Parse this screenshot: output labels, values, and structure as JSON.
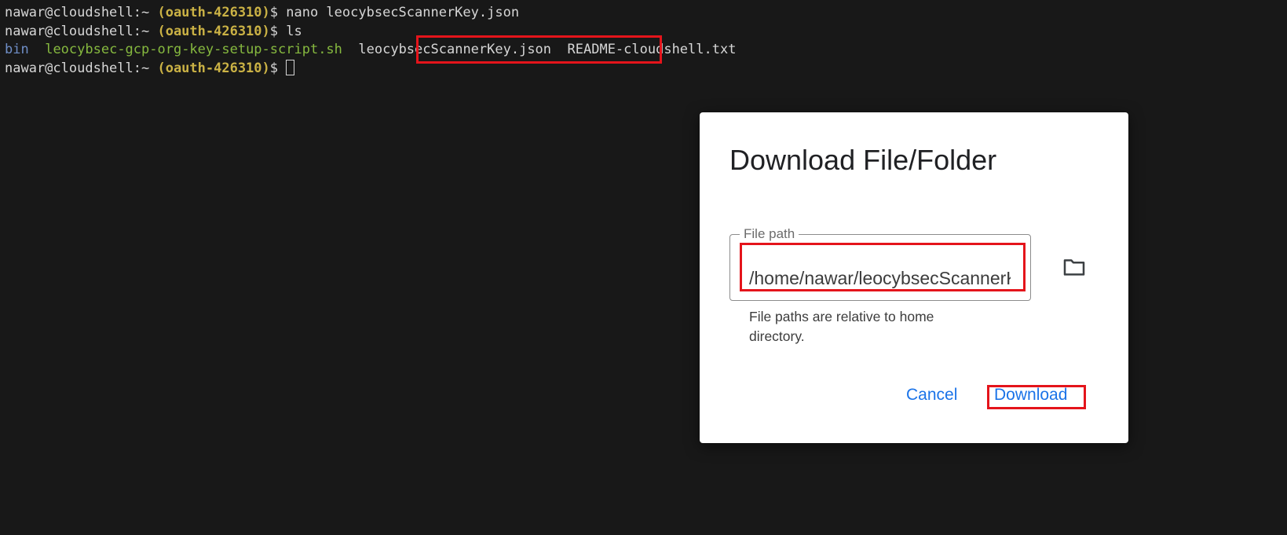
{
  "terminal": {
    "lines": [
      {
        "user": "nawar@cloudshell:~ ",
        "project": "(oauth-426310)",
        "prompt_suffix": "$ ",
        "command": "nano leocybsecScannerKey.json"
      },
      {
        "user": "nawar@cloudshell:~ ",
        "project": "(oauth-426310)",
        "prompt_suffix": "$ ",
        "command": "ls"
      },
      {
        "listing": {
          "dir": "bin",
          "script": "leocybsec-gcp-org-key-setup-script.sh",
          "key_file": "leocybsecScannerKey.json",
          "readme": "README-cloudshell.txt"
        }
      },
      {
        "user": "nawar@cloudshell:~ ",
        "project": "(oauth-426310)",
        "prompt_suffix": "$ "
      }
    ]
  },
  "dialog": {
    "title": "Download File/Folder",
    "field_label": "File path",
    "field_value": "/home/nawar/leocybsecScannerKey.json",
    "hint": "File paths are relative to home directory.",
    "cancel_label": "Cancel",
    "download_label": "Download"
  },
  "icons": {
    "browse": "folder-icon"
  },
  "colors": {
    "terminal_bg": "#181818",
    "project": "#cbb245",
    "directory": "#6f8ec7",
    "executable": "#86b93f",
    "button": "#1a73e8",
    "highlight": "#e4141b"
  }
}
